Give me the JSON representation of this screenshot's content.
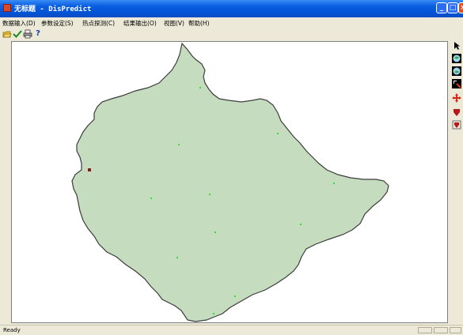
{
  "window": {
    "title": "无标题 - DisPredict",
    "minimize_glyph": "_",
    "maximize_glyph": "□",
    "close_glyph": "×"
  },
  "menu": {
    "items": [
      {
        "label": "数据输入(D)"
      },
      {
        "label": "参数设定(S)"
      },
      {
        "label": "热点探测(C)"
      },
      {
        "label": "结果输出(O)"
      },
      {
        "label": "视图(V)"
      },
      {
        "label": "帮助(H)"
      }
    ]
  },
  "toolbar": {
    "buttons": [
      {
        "icon": "open-folder-icon"
      },
      {
        "icon": "check-icon"
      },
      {
        "icon": "print-icon"
      },
      {
        "icon": "help-icon"
      }
    ],
    "help_glyph": "?"
  },
  "palette": {
    "tools": [
      {
        "icon": "pointer-icon"
      },
      {
        "icon": "zoom-in-globe-icon"
      },
      {
        "icon": "zoom-out-globe-icon"
      },
      {
        "icon": "zoom-extent-icon"
      },
      {
        "icon": "pan-icon"
      },
      {
        "icon": "marker-icon"
      },
      {
        "icon": "marker-settings-icon"
      }
    ]
  },
  "map": {
    "region_fill": "#c5dcbf",
    "region_stroke": "#3c3c3c",
    "point_color": "#33dd33",
    "highlight_color": "#8b1a1a"
  },
  "status": {
    "text": "Ready"
  }
}
